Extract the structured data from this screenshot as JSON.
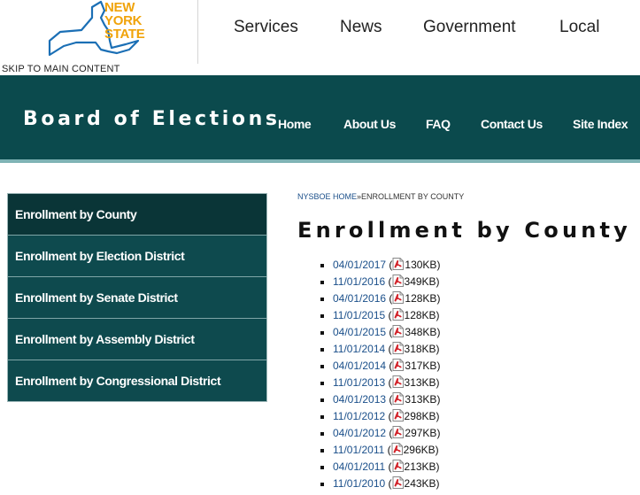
{
  "nys_header": {
    "logo_lines": [
      "NEW",
      "YORK",
      "STATE"
    ],
    "nav": [
      "Services",
      "News",
      "Government",
      "Local"
    ],
    "skip_link": "SKIP TO MAIN CONTENT"
  },
  "agency": {
    "title": "Board of Elections",
    "nav": [
      "Home",
      "About Us",
      "FAQ",
      "Contact Us",
      "Site Index"
    ]
  },
  "sidebar": {
    "items": [
      "Enrollment by County",
      "Enrollment by Election District",
      "Enrollment by Senate District",
      "Enrollment by Assembly District",
      "Enrollment by Congressional District"
    ]
  },
  "breadcrumb": {
    "home": "NYSBOE HOME",
    "separator": "»",
    "current": "ENROLLMENT BY COUNTY"
  },
  "page_title": "Enrollment by County",
  "files": [
    {
      "date": "04/01/2017",
      "size": "130KB"
    },
    {
      "date": "11/01/2016",
      "size": "349KB"
    },
    {
      "date": "04/01/2016",
      "size": "128KB"
    },
    {
      "date": "11/01/2015",
      "size": "128KB"
    },
    {
      "date": "04/01/2015",
      "size": "348KB"
    },
    {
      "date": "11/01/2014",
      "size": "318KB"
    },
    {
      "date": "04/01/2014",
      "size": "317KB"
    },
    {
      "date": "11/01/2013",
      "size": "313KB"
    },
    {
      "date": "04/01/2013",
      "size": "313KB"
    },
    {
      "date": "11/01/2012",
      "size": "298KB"
    },
    {
      "date": "04/01/2012",
      "size": "297KB"
    },
    {
      "date": "11/01/2011",
      "size": "296KB"
    },
    {
      "date": "04/01/2011",
      "size": "213KB"
    },
    {
      "date": "11/01/2010",
      "size": "243KB"
    }
  ],
  "colors": {
    "banner": "#0b4a4d",
    "logo_gold": "#f0a30a",
    "logo_blue": "#1b6fb5",
    "link": "#1a4f8a"
  }
}
